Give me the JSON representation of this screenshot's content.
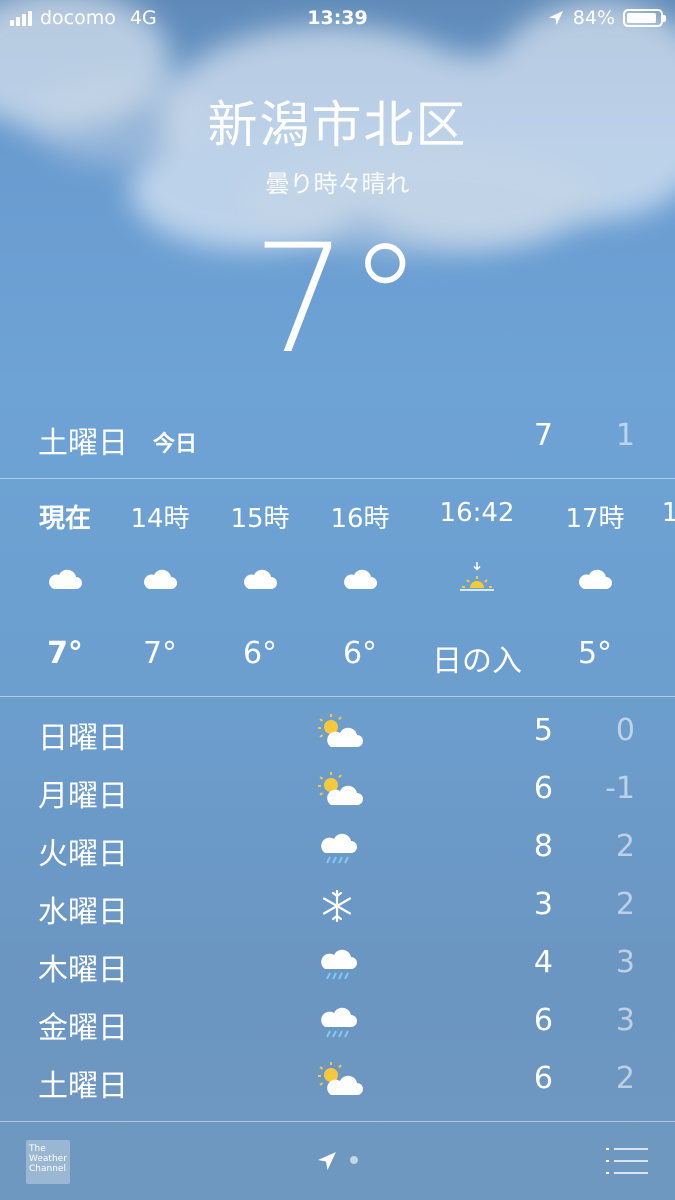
{
  "status_bar": {
    "carrier": "docomo",
    "network": "4G",
    "time": "13:39",
    "battery": "84%"
  },
  "location": {
    "city": "新潟市北区",
    "condition": "曇り時々晴れ",
    "temperature": "7°"
  },
  "today": {
    "day": "土曜日",
    "badge": "今日",
    "high": "7",
    "low": "1"
  },
  "hourly": [
    {
      "time": "現在",
      "icon": "cloud-icon",
      "temp": "7°",
      "bold": true
    },
    {
      "time": "14時",
      "icon": "cloud-icon",
      "temp": "7°"
    },
    {
      "time": "15時",
      "icon": "cloud-icon",
      "temp": "6°"
    },
    {
      "time": "16時",
      "icon": "cloud-icon",
      "temp": "6°"
    },
    {
      "time": "16:42",
      "icon": "sunset-icon",
      "temp": "日の入"
    },
    {
      "time": "17時",
      "icon": "cloud-icon",
      "temp": "5°"
    },
    {
      "time": "1",
      "icon": "",
      "temp": ""
    }
  ],
  "daily": [
    {
      "day": "日曜日",
      "icon": "partly-cloudy-icon",
      "high": "5",
      "low": "0"
    },
    {
      "day": "月曜日",
      "icon": "partly-cloudy-icon",
      "high": "6",
      "low": "-1"
    },
    {
      "day": "火曜日",
      "icon": "rain-icon",
      "high": "8",
      "low": "2"
    },
    {
      "day": "水曜日",
      "icon": "snowflake-icon",
      "high": "3",
      "low": "2"
    },
    {
      "day": "木曜日",
      "icon": "rain-icon",
      "high": "4",
      "low": "3"
    },
    {
      "day": "金曜日",
      "icon": "rain-icon",
      "high": "6",
      "low": "3"
    },
    {
      "day": "土曜日",
      "icon": "partly-cloudy-icon",
      "high": "6",
      "low": "2"
    }
  ],
  "bottom_bar": {
    "logo_text": "The Weather Channel"
  },
  "colors": {
    "sun": "#f6c93c",
    "rain": "#7fc8f5"
  }
}
